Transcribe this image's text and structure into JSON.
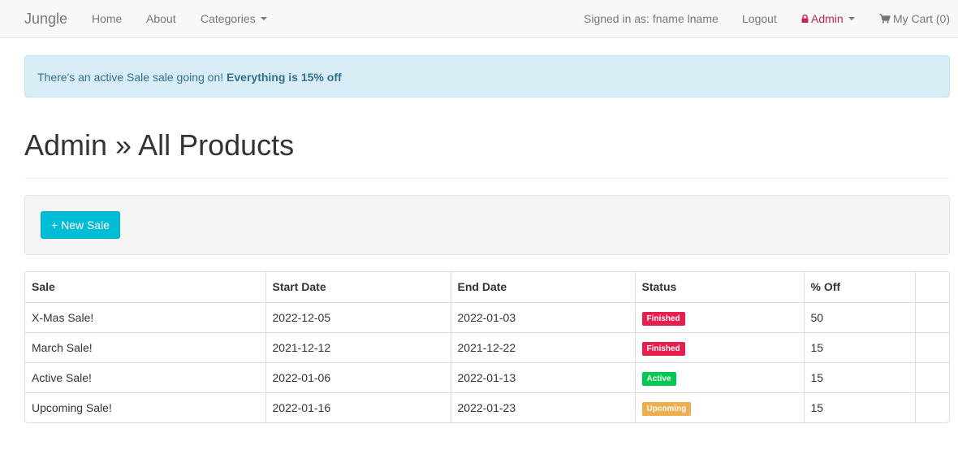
{
  "navbar": {
    "brand": "Jungle",
    "home": "Home",
    "about": "About",
    "categories": "Categories",
    "signed_in": "Signed in as: fname lname",
    "logout": "Logout",
    "admin": "Admin",
    "cart": "My Cart (0)"
  },
  "alert": {
    "prefix": "There's an active Sale sale going on! ",
    "emphasis": "Everything is 15% off"
  },
  "page": {
    "title": "Admin » All Products"
  },
  "actions": {
    "new_sale": "+ New Sale"
  },
  "table": {
    "headers": [
      "Sale",
      "Start Date",
      "End Date",
      "Status",
      "% Off",
      ""
    ],
    "rows": [
      {
        "sale": "X-Mas Sale!",
        "start": "2022-12-05",
        "end": "2022-01-03",
        "status": "Finished",
        "status_color": "#e91e4e",
        "off": "50"
      },
      {
        "sale": "March Sale!",
        "start": "2021-12-12",
        "end": "2021-12-22",
        "status": "Finished",
        "status_color": "#e91e4e",
        "off": "15"
      },
      {
        "sale": "Active Sale!",
        "start": "2022-01-06",
        "end": "2022-01-13",
        "status": "Active",
        "status_color": "#00c853",
        "off": "15"
      },
      {
        "sale": "Upcoming Sale!",
        "start": "2022-01-16",
        "end": "2022-01-23",
        "status": "Upcoming",
        "status_color": "#f0ad4e",
        "off": "15"
      }
    ]
  }
}
